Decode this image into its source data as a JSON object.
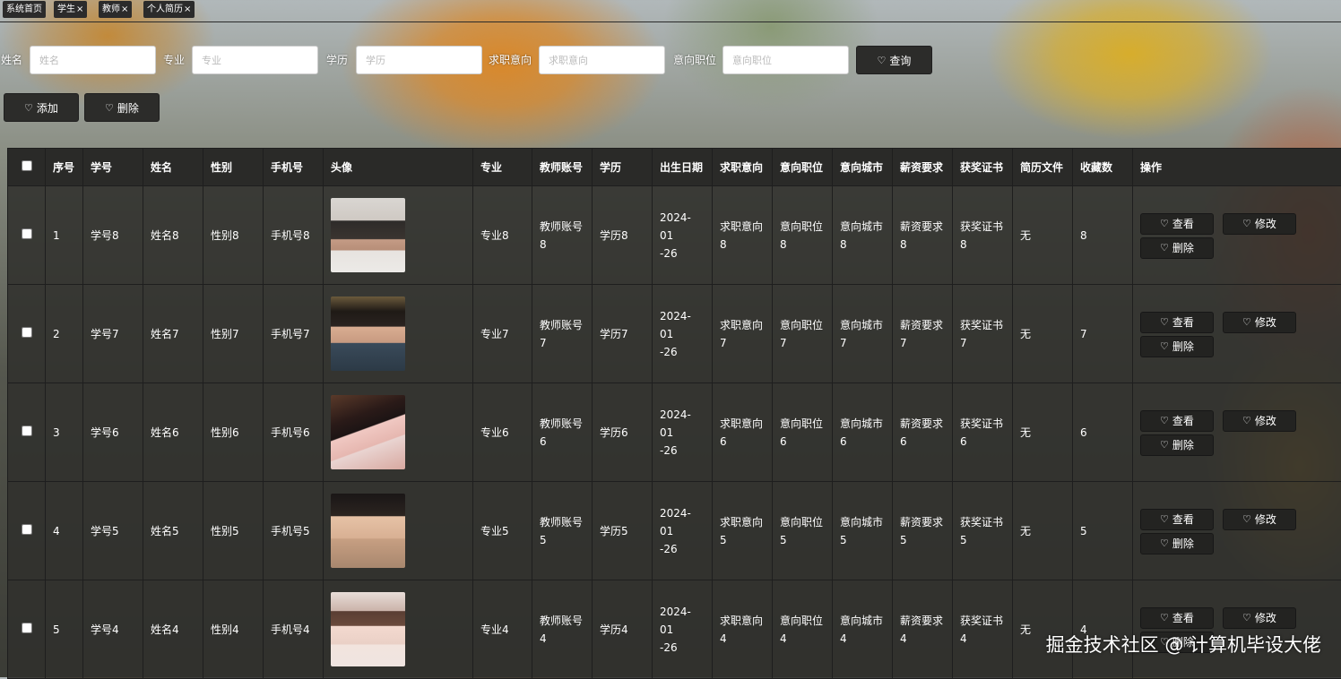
{
  "tabs": [
    {
      "label": "系统首页",
      "closable": false
    },
    {
      "label": "学生",
      "closable": true
    },
    {
      "label": "教师",
      "closable": true
    },
    {
      "label": "个人简历",
      "closable": true
    }
  ],
  "close_glyph": "×",
  "filters": [
    {
      "label": "姓名",
      "placeholder": "姓名"
    },
    {
      "label": "专业",
      "placeholder": "专业"
    },
    {
      "label": "学历",
      "placeholder": "学历"
    },
    {
      "label": "求职意向",
      "placeholder": "求职意向"
    },
    {
      "label": "意向职位",
      "placeholder": "意向职位"
    }
  ],
  "buttons": {
    "search": "查询",
    "add": "添加",
    "delete": "删除"
  },
  "icons": {
    "heart": "♡"
  },
  "table": {
    "headers": [
      "序号",
      "学号",
      "姓名",
      "性别",
      "手机号",
      "头像",
      "专业",
      "教师账号",
      "学历",
      "出生日期",
      "求职意向",
      "意向职位",
      "意向城市",
      "薪资要求",
      "获奖证书",
      "简历文件",
      "收藏数",
      "操作"
    ],
    "actions": {
      "view": "查看",
      "edit": "修改",
      "delete": "删除"
    },
    "rows": [
      {
        "index": "1",
        "student_id": "学号8",
        "name": "姓名8",
        "gender": "性别8",
        "phone": "手机号8",
        "avatar_desc": "avatar-photo",
        "major": "专业8",
        "teacher_line1": "教师账号",
        "teacher_line2": "8",
        "degree": "学历8",
        "birth_line1": "2024-01",
        "birth_line2": "-26",
        "intent_line1": "求职意向",
        "intent_line2": "8",
        "position_line1": "意向职位",
        "position_line2": "8",
        "city_line1": "意向城市",
        "city_line2": "8",
        "salary_line1": "薪资要求",
        "salary_line2": "8",
        "award_line1": "获奖证书",
        "award_line2": "8",
        "resume": "无",
        "favorites": "8"
      },
      {
        "index": "2",
        "student_id": "学号7",
        "name": "姓名7",
        "gender": "性别7",
        "phone": "手机号7",
        "avatar_desc": "avatar-photo",
        "major": "专业7",
        "teacher_line1": "教师账号",
        "teacher_line2": "7",
        "degree": "学历7",
        "birth_line1": "2024-01",
        "birth_line2": "-26",
        "intent_line1": "求职意向",
        "intent_line2": "7",
        "position_line1": "意向职位",
        "position_line2": "7",
        "city_line1": "意向城市",
        "city_line2": "7",
        "salary_line1": "薪资要求",
        "salary_line2": "7",
        "award_line1": "获奖证书",
        "award_line2": "7",
        "resume": "无",
        "favorites": "7"
      },
      {
        "index": "3",
        "student_id": "学号6",
        "name": "姓名6",
        "gender": "性别6",
        "phone": "手机号6",
        "avatar_desc": "avatar-photo",
        "major": "专业6",
        "teacher_line1": "教师账号",
        "teacher_line2": "6",
        "degree": "学历6",
        "birth_line1": "2024-01",
        "birth_line2": "-26",
        "intent_line1": "求职意向",
        "intent_line2": "6",
        "position_line1": "意向职位",
        "position_line2": "6",
        "city_line1": "意向城市",
        "city_line2": "6",
        "salary_line1": "薪资要求",
        "salary_line2": "6",
        "award_line1": "获奖证书",
        "award_line2": "6",
        "resume": "无",
        "favorites": "6"
      },
      {
        "index": "4",
        "student_id": "学号5",
        "name": "姓名5",
        "gender": "性别5",
        "phone": "手机号5",
        "avatar_desc": "avatar-photo",
        "major": "专业5",
        "teacher_line1": "教师账号",
        "teacher_line2": "5",
        "degree": "学历5",
        "birth_line1": "2024-01",
        "birth_line2": "-26",
        "intent_line1": "求职意向",
        "intent_line2": "5",
        "position_line1": "意向职位",
        "position_line2": "5",
        "city_line1": "意向城市",
        "city_line2": "5",
        "salary_line1": "薪资要求",
        "salary_line2": "5",
        "award_line1": "获奖证书",
        "award_line2": "5",
        "resume": "无",
        "favorites": "5"
      },
      {
        "index": "5",
        "student_id": "学号4",
        "name": "姓名4",
        "gender": "性别4",
        "phone": "手机号4",
        "avatar_desc": "avatar-photo",
        "major": "专业4",
        "teacher_line1": "教师账号",
        "teacher_line2": "4",
        "degree": "学历4",
        "birth_line1": "2024-01",
        "birth_line2": "-26",
        "intent_line1": "求职意向",
        "intent_line2": "4",
        "position_line1": "意向职位",
        "position_line2": "4",
        "city_line1": "意向城市",
        "city_line2": "4",
        "salary_line1": "薪资要求",
        "salary_line2": "4",
        "award_line1": "获奖证书",
        "award_line2": "4",
        "resume": "无",
        "favorites": "4"
      }
    ]
  },
  "watermark": "掘金技术社区 @ 计算机毕设大佬",
  "colors": {
    "button_bg": "#2c2c2a",
    "header_bg": "#2a2a28",
    "row_bg": "#30302c",
    "border": "#1e1e1e"
  }
}
